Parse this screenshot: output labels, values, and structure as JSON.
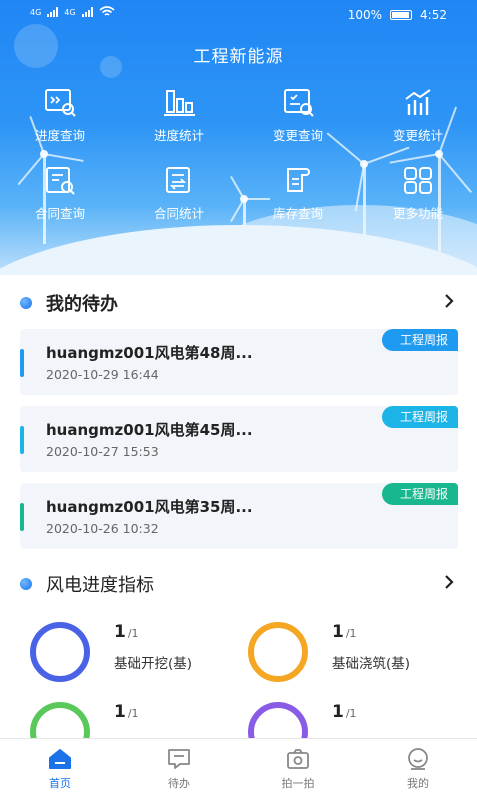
{
  "status_bar": {
    "network_labels": [
      "4G",
      "4G"
    ],
    "battery": "100%",
    "time": "4:52"
  },
  "app_title": "工程新能源",
  "grid": [
    {
      "label": "进度查询",
      "icon": "progress-search-icon"
    },
    {
      "label": "进度统计",
      "icon": "progress-stats-icon"
    },
    {
      "label": "变更查询",
      "icon": "change-search-icon"
    },
    {
      "label": "变更统计",
      "icon": "change-stats-icon"
    },
    {
      "label": "合同查询",
      "icon": "contract-search-icon"
    },
    {
      "label": "合同统计",
      "icon": "contract-stats-icon"
    },
    {
      "label": "库存查询",
      "icon": "inventory-search-icon"
    },
    {
      "label": "更多功能",
      "icon": "more-functions-icon"
    }
  ],
  "todo": {
    "title": "我的待办",
    "items": [
      {
        "title": "huangmz001风电第48周...",
        "time": "2020-10-29 16:44",
        "tag": "工程周报",
        "accent": "#1e9bf0"
      },
      {
        "title": "huangmz001风电第45周...",
        "time": "2020-10-27 15:53",
        "tag": "工程周报",
        "accent": "#1cb3e6"
      },
      {
        "title": "huangmz001风电第35周...",
        "time": "2020-10-26 10:32",
        "tag": "工程周报",
        "accent": "#19b78f"
      }
    ]
  },
  "metrics": {
    "title": "风电进度指标",
    "items": [
      {
        "value": "1",
        "total": "/1",
        "label": "基础开挖(基)",
        "color": "#4a63e6"
      },
      {
        "value": "1",
        "total": "/1",
        "label": "基础浇筑(基)",
        "color": "#f5a623"
      },
      {
        "value": "1",
        "total": "/1",
        "label": "",
        "color": "#5ac85a"
      },
      {
        "value": "1",
        "total": "/1",
        "label": "",
        "color": "#8a5ce6"
      }
    ]
  },
  "bottom_nav": [
    {
      "label": "首页",
      "icon": "home-icon",
      "active": true
    },
    {
      "label": "待办",
      "icon": "todo-icon",
      "active": false
    },
    {
      "label": "拍一拍",
      "icon": "camera-icon",
      "active": false
    },
    {
      "label": "我的",
      "icon": "profile-icon",
      "active": false
    }
  ],
  "colors": {
    "primary": "#1a73e8",
    "hero_top": "#1f86f5"
  }
}
